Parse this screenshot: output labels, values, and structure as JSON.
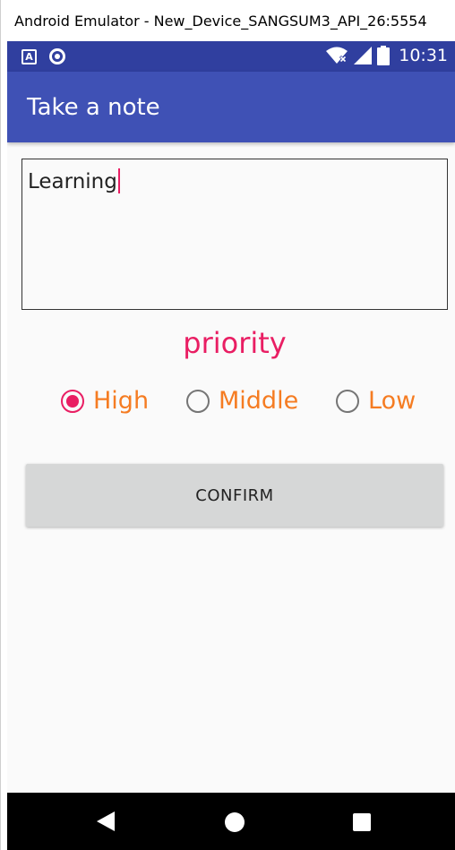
{
  "window": {
    "title": "Android Emulator - New_Device_SANGSUM3_API_26:5554"
  },
  "status_bar": {
    "notification_icon_letter": "A",
    "time": "10:31",
    "icons": [
      "notification-a-icon",
      "sync-icon",
      "wifi-icon",
      "signal-icon",
      "battery-icon"
    ]
  },
  "app_bar": {
    "title": "Take a note"
  },
  "note": {
    "value": "Learning"
  },
  "priority": {
    "label": "priority",
    "options": [
      {
        "label": "High",
        "checked": true
      },
      {
        "label": "Middle",
        "checked": false
      },
      {
        "label": "Low",
        "checked": false
      }
    ]
  },
  "confirm": {
    "label": "CONFIRM"
  },
  "colors": {
    "primary": "#3f51b5",
    "primary_dark": "#303f9f",
    "accent": "#e91e63",
    "radio_text": "#f57c22"
  }
}
